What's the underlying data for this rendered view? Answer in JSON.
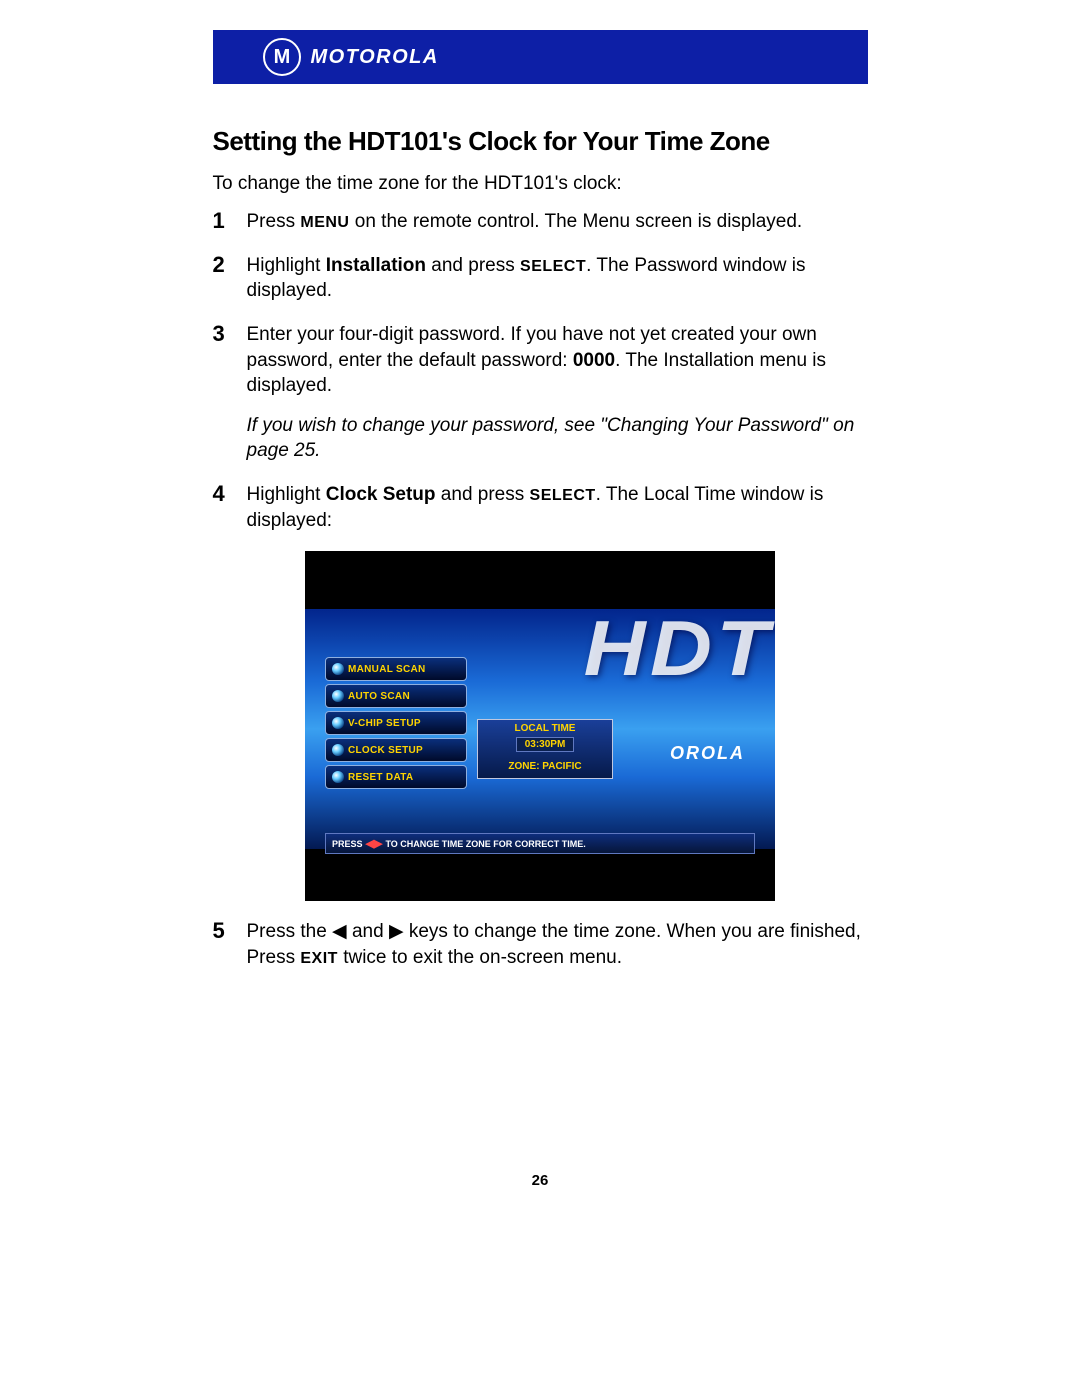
{
  "brand": {
    "logo_letter": "M",
    "wordmark": "MOTOROLA"
  },
  "heading": "Setting the HDT101's Clock for Your Time Zone",
  "intro": "To change the time zone for the HDT101's clock:",
  "steps": [
    {
      "n": "1",
      "pre": "Press ",
      "sc1": "MENU",
      "post": " on the remote control. The Menu screen is displayed."
    },
    {
      "n": "2",
      "pre": "Highlight ",
      "bold": "Installation",
      "mid": " and press ",
      "sc1": "SELECT",
      "post": ". The Password window is displayed."
    },
    {
      "n": "3",
      "pre": "Enter your four-digit password. If you have not yet created your own password, enter the default password: ",
      "bold": "0000",
      "post": ". The Installation menu is displayed.",
      "note": "If you wish to change your password, see \"Changing Your Password\" on page 25."
    },
    {
      "n": "4",
      "pre": "Highlight ",
      "bold": "Clock Setup",
      "mid": " and press ",
      "sc1": "SELECT",
      "post": ". The Local Time window is displayed:"
    },
    {
      "n": "5",
      "pre": "Press the ",
      "arrow1": "◀",
      "mid1": " and ",
      "arrow2": "▶",
      "mid2": " keys to change the time zone. When you are finished, Press ",
      "sc1": "EXIT",
      "post": " twice to exit the on-screen menu."
    }
  ],
  "screenshot": {
    "menu_items": [
      "MANUAL SCAN",
      "AUTO SCAN",
      "V-CHIP SETUP",
      "CLOCK SETUP",
      "RESET DATA"
    ],
    "dialog": {
      "label": "LOCAL TIME",
      "time": "03:30PM",
      "zone": "ZONE: PACIFIC"
    },
    "help_pre": "PRESS ",
    "help_arrows": "◀▶",
    "help_post": " TO CHANGE TIME ZONE FOR CORRECT TIME.",
    "bg_text": "HDTV",
    "brand": "OROLA"
  },
  "page_number": "26"
}
